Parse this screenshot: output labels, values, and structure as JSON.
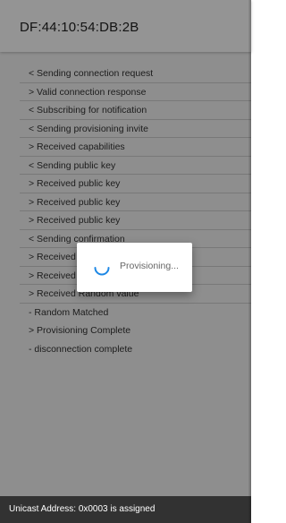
{
  "appbar": {
    "title": "DF:44:10:54:DB:2B"
  },
  "log": {
    "items": [
      "< Sending connection request",
      "> Valid connection response",
      "< Subscribing for notification",
      "< Sending provisioning invite",
      "> Received capabilities",
      "< Sending public key",
      "> Received public key",
      "> Received public key",
      "> Received public key",
      "< Sending confirmation",
      "> Received confirmation",
      "> Received random",
      "> Received Random value",
      "- Random Matched",
      "> Provisioning Complete",
      "- disconnection complete"
    ]
  },
  "dialog": {
    "message": "Provisioning...",
    "icon": "spinner-icon"
  },
  "snackbar": {
    "text": "Unicast Address: 0x0003 is assigned"
  },
  "colors": {
    "appbar_bg": "#ffffff",
    "scrim": "rgba(0,0,0,0.42)",
    "spinner": "#1e88e5",
    "snackbar_bg": "#323232"
  }
}
